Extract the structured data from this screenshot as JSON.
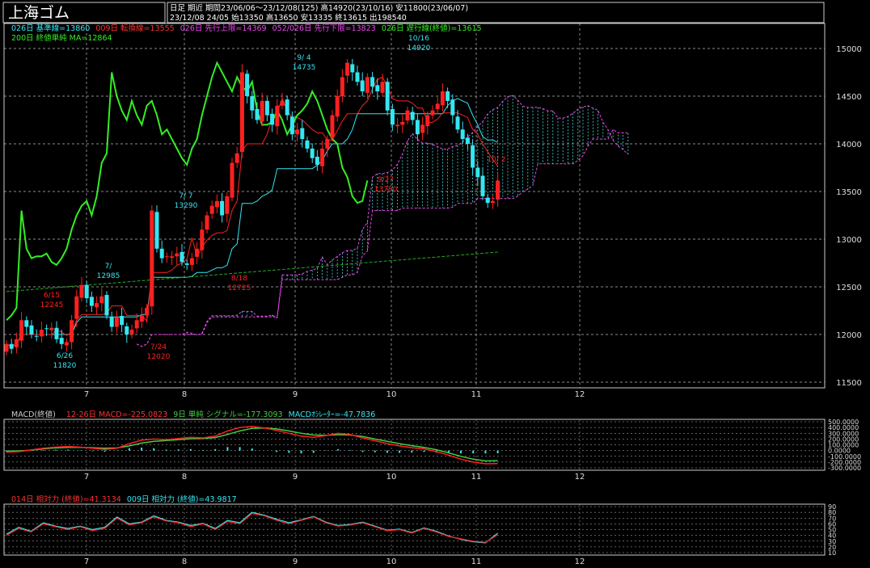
{
  "header": {
    "title": "上海ゴム",
    "row1": "日足  期近  期間23/06/06～23/12/08(125) 高14920(23/10/16) 安11800(23/06/07)",
    "row2": "23/12/08 24/05  始13350 高13650 安13335 終13615 出198540"
  },
  "legend": {
    "kijun": "026日 基準線=13860",
    "tenkan": "009日 転換線=13555",
    "senkou_a": "026日 先行上限=14369",
    "senkou_b": "052/026日 先行下限=13823",
    "chikou": "026日 遅行線(終値)=13615",
    "ma200": "200日 終値単純 MA=12864"
  },
  "macd_legend": {
    "label": "MACD(終値)",
    "macd": "12-26日 MACD=-225.0823",
    "signal": "9日 単純 シグナル=-177.3093",
    "osc": "MACDｵｼﾚｰﾀｰ=-47.7836"
  },
  "rsi_legend": {
    "rsi14": "014日 相対力 (終値)=41.3134",
    "rsi9": "009日 相対力 (終値)=43.9817"
  },
  "colors": {
    "background": "#000000",
    "grid": "#bbbbbb",
    "up": "#ff2020",
    "down": "#35e6f2",
    "tenkan": "#ff2020",
    "kijun": "#35e6f2",
    "chikou": "#33ee22",
    "ma200": "#22aa22",
    "cloud_a": "#ee44ee",
    "cloud_b": "#44dddd",
    "macd": "#ff2020",
    "signal": "#44cc44",
    "osc": "#35e6f2",
    "rsi14": "#ff2020",
    "rsi9": "#35e6f2"
  },
  "annotations": [
    {
      "label": "6/26",
      "value": "11820"
    },
    {
      "label": "6/15",
      "value": "12245"
    },
    {
      "label": "7/",
      "value": "12985"
    },
    {
      "label": "7/24",
      "value": "12020"
    },
    {
      "label": "7/ 7",
      "value": "13290"
    },
    {
      "label": "8/18",
      "value": "12725"
    },
    {
      "label": "9/ 4",
      "value": "14735"
    },
    {
      "label": "9/27",
      "value": "13780"
    },
    {
      "label": "10/16",
      "value": "14920"
    },
    {
      "label": "10/ 2",
      "value": ""
    }
  ],
  "chart_data": [
    {
      "type": "candlestick",
      "x_ticks": [
        "7",
        "8",
        "9",
        "10",
        "11",
        "12"
      ],
      "y_ticks": [
        "15000",
        "14500",
        "14000",
        "13500",
        "13000",
        "12500",
        "12000",
        "11500"
      ],
      "ylim": [
        11500,
        15000
      ],
      "grid": true,
      "closes": [
        11900,
        11850,
        11950,
        12150,
        12080,
        12000,
        11980,
        12050,
        12060,
        12070,
        11950,
        11900,
        11920,
        12150,
        12400,
        12520,
        12380,
        12300,
        12330,
        12400,
        12200,
        12080,
        12180,
        12100,
        12000,
        12050,
        12150,
        12200,
        12280,
        13300,
        12900,
        12800,
        12820,
        12820,
        12850,
        12760,
        12730,
        12800,
        12900,
        13100,
        13250,
        13350,
        13400,
        13250,
        13450,
        13800,
        13900,
        14750,
        14500,
        14350,
        14250,
        14450,
        14300,
        14200,
        14400,
        14450,
        14300,
        14100,
        14150,
        14050,
        13950,
        13850,
        13780,
        13950,
        14050,
        14300,
        14500,
        14700,
        14850,
        14750,
        14650,
        14550,
        14700,
        14600,
        14550,
        14650,
        14350,
        14200,
        14200,
        14230,
        14350,
        14250,
        14100,
        14200,
        14300,
        14350,
        14420,
        14550,
        14450,
        14300,
        14150,
        14050,
        14000,
        13750,
        13650,
        13450,
        13380,
        13400,
        13615
      ],
      "tenkan_last": 13555,
      "kijun_last": 13860,
      "senkou_a_last": 14369,
      "senkou_b_last": 13823,
      "chikou_last": 13615,
      "ma200_last": 12864
    },
    {
      "type": "line",
      "title": "MACD(終値)",
      "y_ticks": [
        "500.0000",
        "400.0000",
        "300.0000",
        "200.0000",
        "100.0000",
        "0.0000",
        "-100.0000",
        "-200.0000",
        "-300.0000"
      ],
      "ylim": [
        -300,
        500
      ],
      "series": [
        {
          "name": "12-26日 MACD",
          "values": [
            -30,
            -20,
            10,
            40,
            60,
            70,
            60,
            40,
            20,
            40,
            120,
            180,
            200,
            190,
            210,
            230,
            220,
            250,
            340,
            400,
            420,
            390,
            350,
            300,
            250,
            230,
            260,
            300,
            280,
            220,
            170,
            120,
            80,
            50,
            30,
            -20,
            -80,
            -150,
            -200,
            -230,
            -225
          ]
        },
        {
          "name": "9日 単純 シグナル",
          "values": [
            -10,
            -5,
            5,
            30,
            45,
            55,
            55,
            50,
            40,
            45,
            80,
            130,
            160,
            175,
            190,
            205,
            210,
            225,
            280,
            340,
            385,
            390,
            375,
            340,
            300,
            270,
            265,
            275,
            270,
            245,
            200,
            160,
            120,
            85,
            55,
            15,
            -40,
            -100,
            -150,
            -180,
            -177
          ]
        }
      ]
    },
    {
      "type": "line",
      "title": "相対力",
      "y_ticks": [
        "90",
        "80",
        "70",
        "60",
        "50",
        "40",
        "30",
        "20",
        "10"
      ],
      "ylim": [
        10,
        90
      ],
      "series": [
        {
          "name": "014日 相対力 (終値)",
          "values": [
            40,
            52,
            46,
            60,
            55,
            50,
            55,
            48,
            52,
            70,
            58,
            62,
            72,
            65,
            62,
            55,
            60,
            50,
            64,
            60,
            78,
            74,
            66,
            60,
            66,
            72,
            62,
            56,
            58,
            62,
            55,
            48,
            50,
            44,
            52,
            46,
            38,
            34,
            30,
            28,
            41
          ]
        },
        {
          "name": "009日 相対力 (終値)",
          "values": [
            42,
            54,
            47,
            62,
            56,
            52,
            56,
            50,
            54,
            72,
            60,
            63,
            74,
            66,
            63,
            57,
            61,
            52,
            66,
            62,
            80,
            75,
            68,
            62,
            67,
            73,
            63,
            57,
            59,
            63,
            56,
            49,
            51,
            45,
            53,
            47,
            39,
            33,
            29,
            27,
            44
          ]
        }
      ]
    }
  ]
}
